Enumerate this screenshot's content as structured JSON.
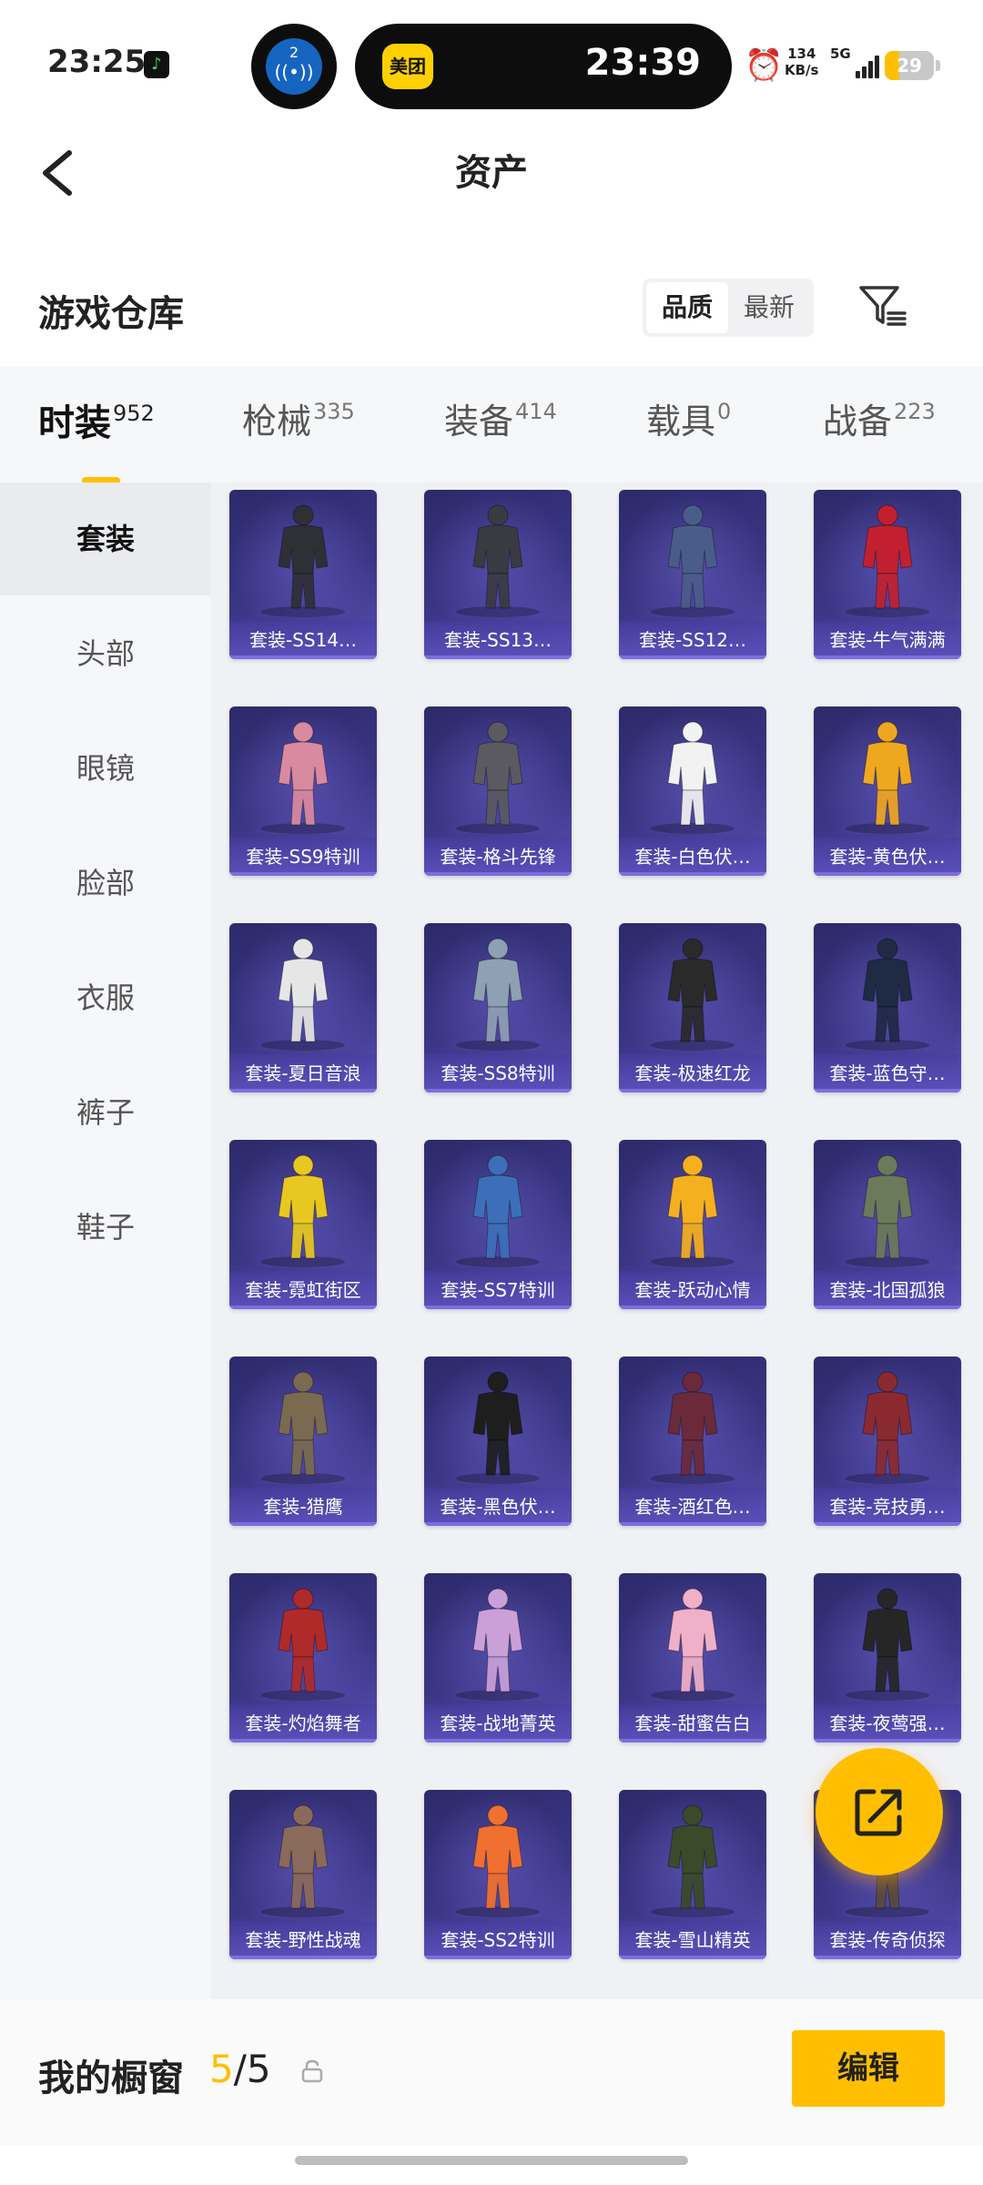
{
  "status_bar": {
    "time": "23:25",
    "bubble_number": "2",
    "island_app": "美团",
    "island_time": "23:39",
    "net_speed_value": "134",
    "net_speed_unit": "KB/s",
    "network": "5G",
    "battery": "29",
    "battery_level": 0.29
  },
  "header": {
    "title": "资产"
  },
  "warehouse": {
    "title": "游戏仓库",
    "sort_options": [
      "品质",
      "最新"
    ],
    "sort_selected": "品质"
  },
  "categories": [
    {
      "label": "时装",
      "count": "952",
      "active": true
    },
    {
      "label": "枪械",
      "count": "335",
      "active": false
    },
    {
      "label": "装备",
      "count": "414",
      "active": false
    },
    {
      "label": "载具",
      "count": "0",
      "active": false
    },
    {
      "label": "战备",
      "count": "223",
      "active": false
    }
  ],
  "sidebar": {
    "items": [
      "套装",
      "头部",
      "眼镜",
      "脸部",
      "衣服",
      "裤子",
      "鞋子"
    ],
    "active": "套装"
  },
  "items": [
    "套装-SS14…",
    "套装-SS13…",
    "套装-SS12…",
    "套装-牛气满满",
    "套装-SS9特训",
    "套装-格斗先锋",
    "套装-白色伏…",
    "套装-黄色伏…",
    "套装-夏日音浪",
    "套装-SS8特训",
    "套装-极速红龙",
    "套装-蓝色守…",
    "套装-霓虹街区",
    "套装-SS7特训",
    "套装-跃动心情",
    "套装-北国孤狼",
    "套装-猎鹰",
    "套装-黑色伏…",
    "套装-酒红色…",
    "套装-竞技勇…",
    "套装-灼焰舞者",
    "套装-战地菁英",
    "套装-甜蜜告白",
    "套装-夜莺强…",
    "套装-野性战魂",
    "套装-SS2特训",
    "套装-雪山精英",
    "套装-传奇侦探"
  ],
  "item_colors": [
    "#2f2f36",
    "#3a3a42",
    "#4a5d8a",
    "#c2202f",
    "#d98aa0",
    "#5a5a60",
    "#f2f2f2",
    "#f0a720",
    "#e6e6e6",
    "#8ea0b4",
    "#2a2a2a",
    "#1f2a44",
    "#e8c820",
    "#3d6fb8",
    "#f5b020",
    "#6b7a5a",
    "#7a6a50",
    "#1e1e1e",
    "#6a2a3a",
    "#8a2a30",
    "#b02a2a",
    "#c9a0d8",
    "#f0b0c8",
    "#262626",
    "#8a6a5a",
    "#f07030",
    "#3a4a2a",
    "#5a4a3a"
  ],
  "showcase": {
    "label": "我的橱窗",
    "current": "5",
    "separator": "/",
    "total": "5",
    "edit_label": "编辑"
  },
  "colors": {
    "accent": "#ffbf00",
    "card_bg": "#3b3585",
    "card_label_bg": "#5a4fb8"
  }
}
